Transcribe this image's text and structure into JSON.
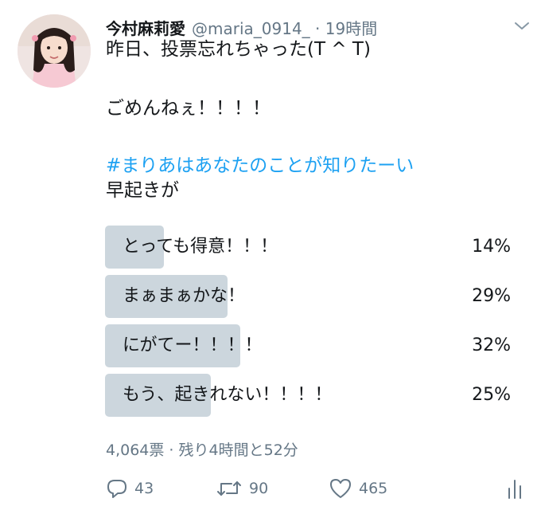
{
  "tweet": {
    "display_name": "今村麻莉愛",
    "handle_time": "@maria_0914_ · 19時間",
    "line1": "昨日、投票忘れちゃった(T ^ T)",
    "line2": "ごめんねぇ！！！！",
    "hashtag": "#まりあはあなたのことが知りたーい",
    "line3": "早起きが"
  },
  "poll": {
    "options": [
      {
        "label": "とっても得意！！！",
        "percent_text": "14%",
        "percent": 14
      },
      {
        "label": "まぁまぁかな！",
        "percent_text": "29%",
        "percent": 29
      },
      {
        "label": "にがてー！！！！",
        "percent_text": "32%",
        "percent": 32
      },
      {
        "label": "もう、起きれない！！！！",
        "percent_text": "25%",
        "percent": 25
      }
    ],
    "meta": "4,064票 · 残り4時間と52分"
  },
  "actions": {
    "replies": "43",
    "retweets": "90",
    "likes": "465"
  },
  "icons": {
    "reply": "reply-icon",
    "retweet": "retweet-icon",
    "like": "heart-icon",
    "analytics": "analytics-icon",
    "menu": "chevron-down-icon"
  },
  "colors": {
    "hashtag": "#1da1f2",
    "poll_fill": "#ccd6dd",
    "secondary_text": "#657786"
  }
}
